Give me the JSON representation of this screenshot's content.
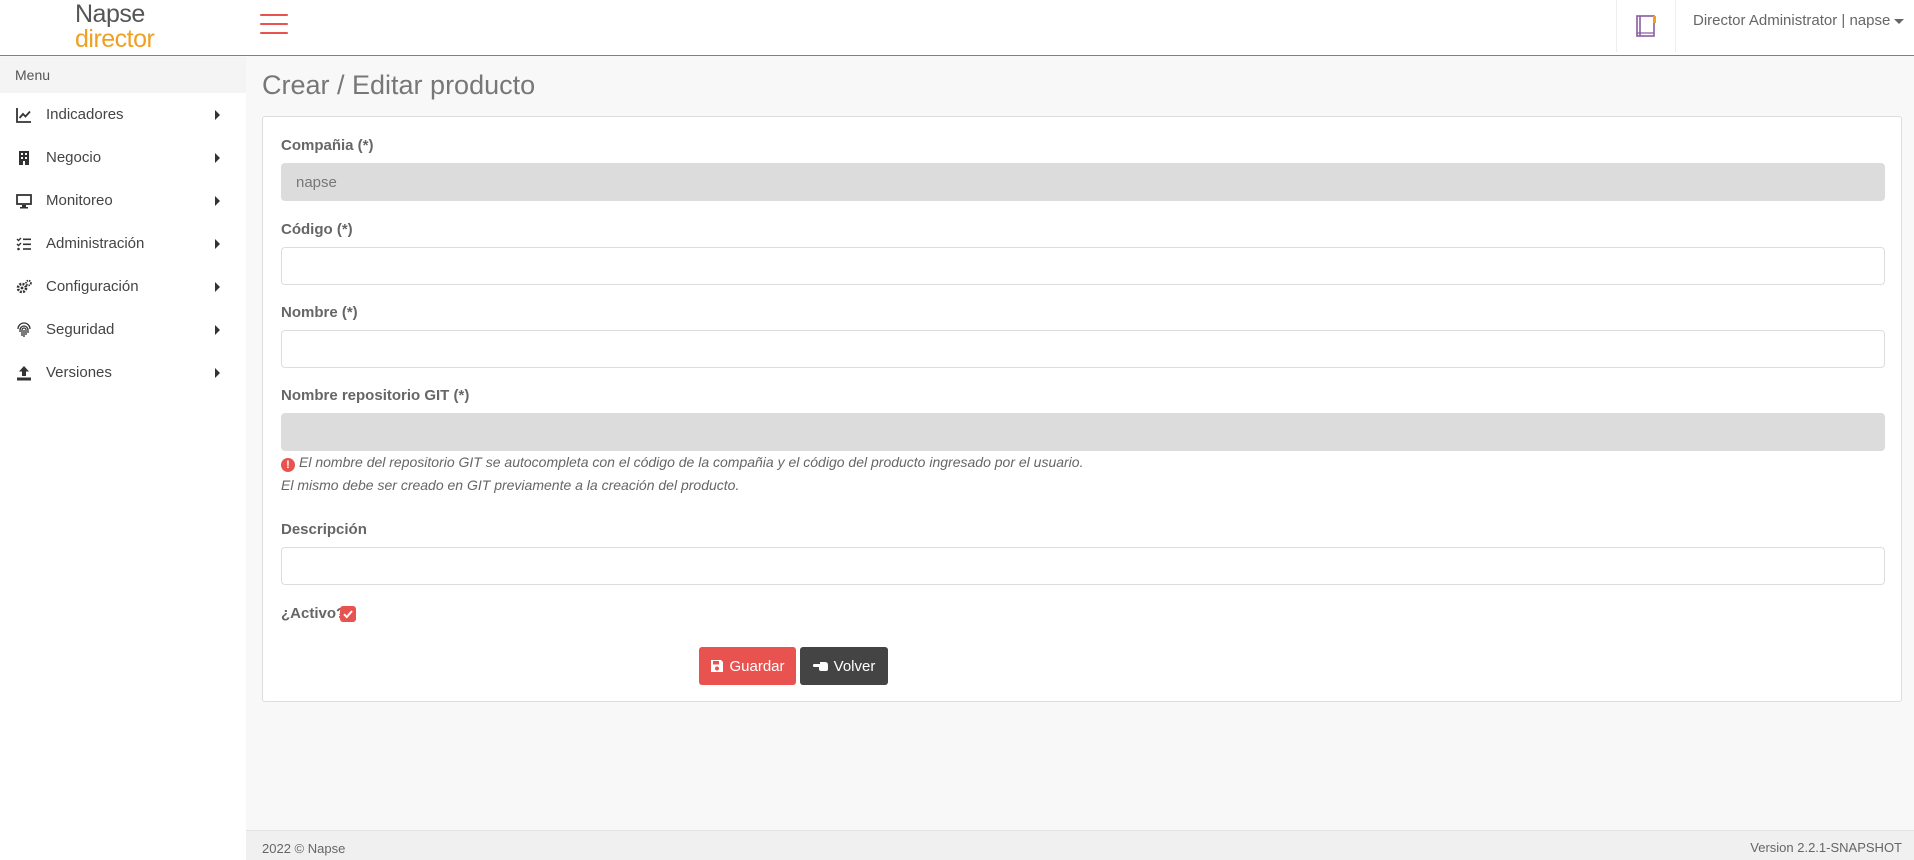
{
  "header": {
    "logo_line1": "Napse",
    "logo_line2": "director",
    "user_label": "Director Administrator | napse",
    "brand_color": "#e8534f",
    "accent_color": "#f0a020"
  },
  "sidebar": {
    "title": "Menu",
    "items": [
      {
        "label": "Indicadores",
        "icon": "chart-line-icon"
      },
      {
        "label": "Negocio",
        "icon": "building-icon"
      },
      {
        "label": "Monitoreo",
        "icon": "monitor-icon"
      },
      {
        "label": "Administración",
        "icon": "tasks-list-icon"
      },
      {
        "label": "Configuración",
        "icon": "gears-icon"
      },
      {
        "label": "Seguridad",
        "icon": "fingerprint-icon"
      },
      {
        "label": "Versiones",
        "icon": "upload-icon"
      }
    ]
  },
  "main": {
    "title": "Crear / Editar producto",
    "form": {
      "company_label": "Compañia (*)",
      "company_value": "napse",
      "code_label": "Código (*)",
      "code_value": "",
      "name_label": "Nombre (*)",
      "name_value": "",
      "git_label": "Nombre repositorio GIT (*)",
      "git_value": "",
      "git_hint_line1": "El nombre del repositorio GIT se autocompleta con el código de la compañia y el código del producto ingresado por el usuario.",
      "git_hint_line2": "El mismo debe ser creado en GIT previamente a la creación del producto.",
      "description_label": "Descripción",
      "description_value": "",
      "active_label": "¿Activo?",
      "active_checked": true,
      "save_label": "Guardar",
      "back_label": "Volver"
    }
  },
  "footer": {
    "copyright": "2022 © Napse",
    "version": "Version 2.2.1-SNAPSHOT"
  }
}
